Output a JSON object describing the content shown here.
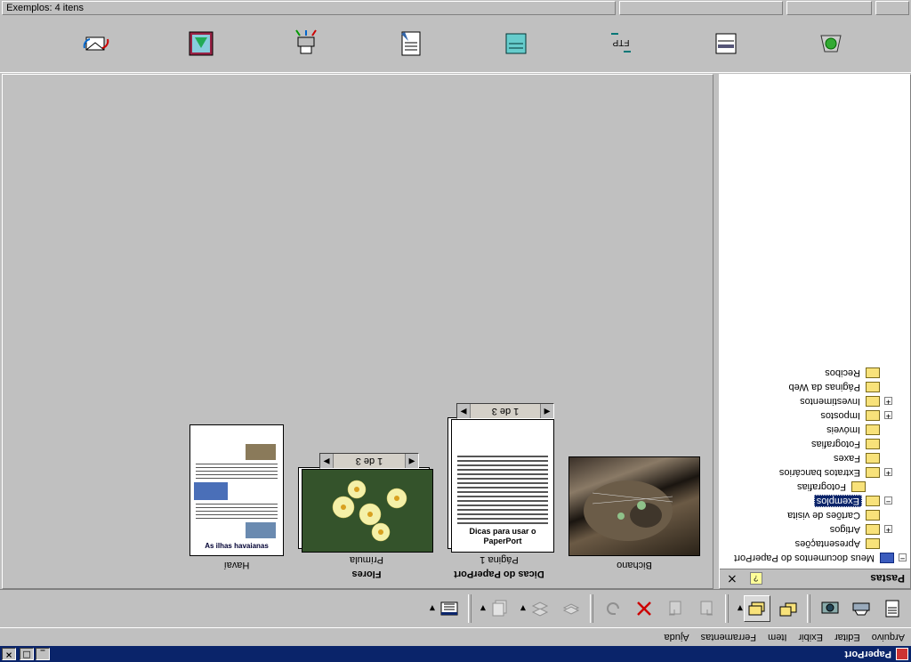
{
  "window": {
    "title": "PaperPort",
    "controls": [
      "_",
      "□",
      "×"
    ]
  },
  "menubar": [
    "Arquivo",
    "Editar",
    "Exibir",
    "Item",
    "Ferramentas",
    "Ajuda"
  ],
  "folders_pane": {
    "title": "Pastas",
    "close": "×",
    "help": "?",
    "tree": [
      {
        "label": "Meus documentos do PaperPort",
        "expander": "−",
        "level": 0,
        "root": true
      },
      {
        "label": "Apresentações",
        "expander": "",
        "level": 1
      },
      {
        "label": "Artigos",
        "expander": "+",
        "level": 1
      },
      {
        "label": "Cartões de visita",
        "expander": "",
        "level": 1
      },
      {
        "label": "Exemplos",
        "expander": "−",
        "level": 1,
        "selected": true
      },
      {
        "label": "Fotografias",
        "expander": "",
        "level": 2
      },
      {
        "label": "Extratos bancários",
        "expander": "+",
        "level": 1
      },
      {
        "label": "Faxes",
        "expander": "",
        "level": 1
      },
      {
        "label": "Fotografias",
        "expander": "",
        "level": 1
      },
      {
        "label": "Imóveis",
        "expander": "",
        "level": 1
      },
      {
        "label": "Impostos",
        "expander": "+",
        "level": 1
      },
      {
        "label": "Investimentos",
        "expander": "+",
        "level": 1
      },
      {
        "label": "Páginas da Web",
        "expander": "",
        "level": 1
      },
      {
        "label": "Recibos",
        "expander": "",
        "level": 1
      }
    ]
  },
  "desktop_items": [
    {
      "title": "",
      "sub": "Bichano",
      "kind": "photo-cat"
    },
    {
      "title": "Dicas do PaperPort",
      "sub": "Página 1",
      "pager": "1 de 3",
      "kind": "doc-stack",
      "doc_heading": "Dicas para usar o PaperPort"
    },
    {
      "title": "Flores",
      "sub": "Prímula",
      "pager": "1 de 3",
      "kind": "photo-flower"
    },
    {
      "title": "",
      "sub": "Havaí",
      "kind": "doc-hawaii",
      "doc_heading": "As ilhas havaianas"
    }
  ],
  "status_bar": {
    "text": "Exemplos: 4 itens"
  },
  "colors": {
    "titlebar": "#0a246a",
    "selection": "#0a246a",
    "folder": "#f8e27a",
    "desktop": "#c0c0c0"
  },
  "toolbar_icons": [
    "new-document-icon",
    "scan-icon",
    "camera-icon",
    "folder-view-icon",
    "desktop-view-icon",
    "rotate-left-icon",
    "rotate-right-icon",
    "delete-icon",
    "undo-icon",
    "stack-icon",
    "unstack-icon",
    "page-icon",
    "details-view-icon"
  ],
  "sendto_icons": [
    "email-icon",
    "photo-editor-icon",
    "printer-icon",
    "word-icon",
    "fax-icon",
    "ftp-icon",
    "scanner-icon",
    "recycle-icon"
  ],
  "sendto_labels": {
    "ftp": "FTP"
  }
}
